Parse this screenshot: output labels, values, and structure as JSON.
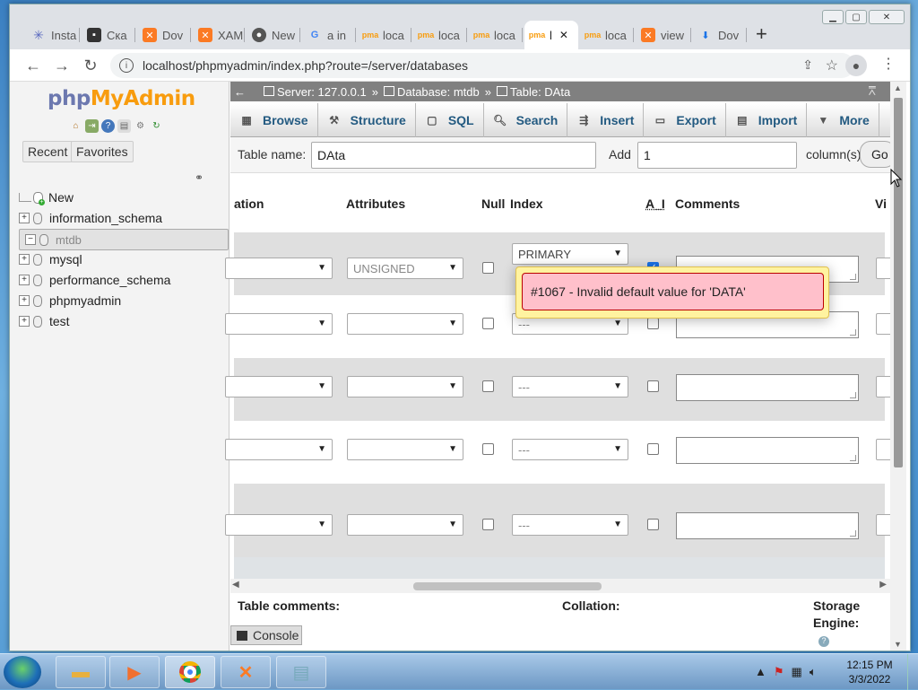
{
  "browser": {
    "tabs": [
      {
        "label": "Insta",
        "icon": "snowflake-icon"
      },
      {
        "label": "Ска",
        "icon": "terminal-icon"
      },
      {
        "label": "Dov",
        "icon": "xampp-icon"
      },
      {
        "label": "XAM",
        "icon": "xampp-icon"
      },
      {
        "label": "New",
        "icon": "chrome-icon"
      },
      {
        "label": "a in",
        "icon": "google-icon"
      },
      {
        "label": "loca",
        "icon": "pma-icon"
      },
      {
        "label": "loca",
        "icon": "pma-icon"
      },
      {
        "label": "loca",
        "icon": "pma-icon"
      },
      {
        "label": "l",
        "icon": "pma-icon"
      },
      {
        "label": "loca",
        "icon": "pma-icon"
      },
      {
        "label": "view",
        "icon": "xampp-icon"
      },
      {
        "label": "Dov",
        "icon": "download-icon"
      }
    ],
    "new_tab": "+",
    "url": "localhost/phpmyadmin/index.php?route=/server/databases"
  },
  "sidebar": {
    "logo_php": "php",
    "logo_myadmin": "MyAdmin",
    "recent": "Recent",
    "favorites": "Favorites",
    "tree": [
      {
        "label": "New"
      },
      {
        "label": "information_schema"
      },
      {
        "label": "mtdb"
      },
      {
        "label": "mysql"
      },
      {
        "label": "performance_schema"
      },
      {
        "label": "phpmyadmin"
      },
      {
        "label": "test"
      }
    ]
  },
  "breadcrumb": {
    "server": "Server: 127.0.0.1",
    "database": "Database: mtdb",
    "table": "Table: DAta"
  },
  "menu": [
    "Browse",
    "Structure",
    "SQL",
    "Search",
    "Insert",
    "Export",
    "Import",
    "More"
  ],
  "form": {
    "table_name_label": "Table name:",
    "table_name_value": "DAta",
    "add_label": "Add",
    "add_value": "1",
    "columns_label": "column(s)",
    "go": "Go"
  },
  "columns_header": {
    "partial_first": "ation",
    "attributes": "Attributes",
    "null": "Null",
    "index": "Index",
    "ai": "A_I",
    "comments": "Comments",
    "partial_last": "Vi"
  },
  "rows": [
    {
      "attribute": "UNSIGNED",
      "index": "PRIMARY",
      "null": false,
      "ai": true
    },
    {
      "attribute": "",
      "index": "---",
      "null": false,
      "ai": false
    },
    {
      "attribute": "",
      "index": "---",
      "null": false,
      "ai": false
    },
    {
      "attribute": "",
      "index": "---",
      "null": false,
      "ai": false
    },
    {
      "attribute": "",
      "index": "---",
      "null": false,
      "ai": false
    }
  ],
  "error": "#1067 - Invalid default value for 'DATA'",
  "footer": {
    "table_comments": "Table comments:",
    "collation": "Collation:",
    "storage": "Storage",
    "engine": "Engine:"
  },
  "console": "Console",
  "taskbar": {
    "time": "12:15 PM",
    "date": "3/3/2022"
  }
}
